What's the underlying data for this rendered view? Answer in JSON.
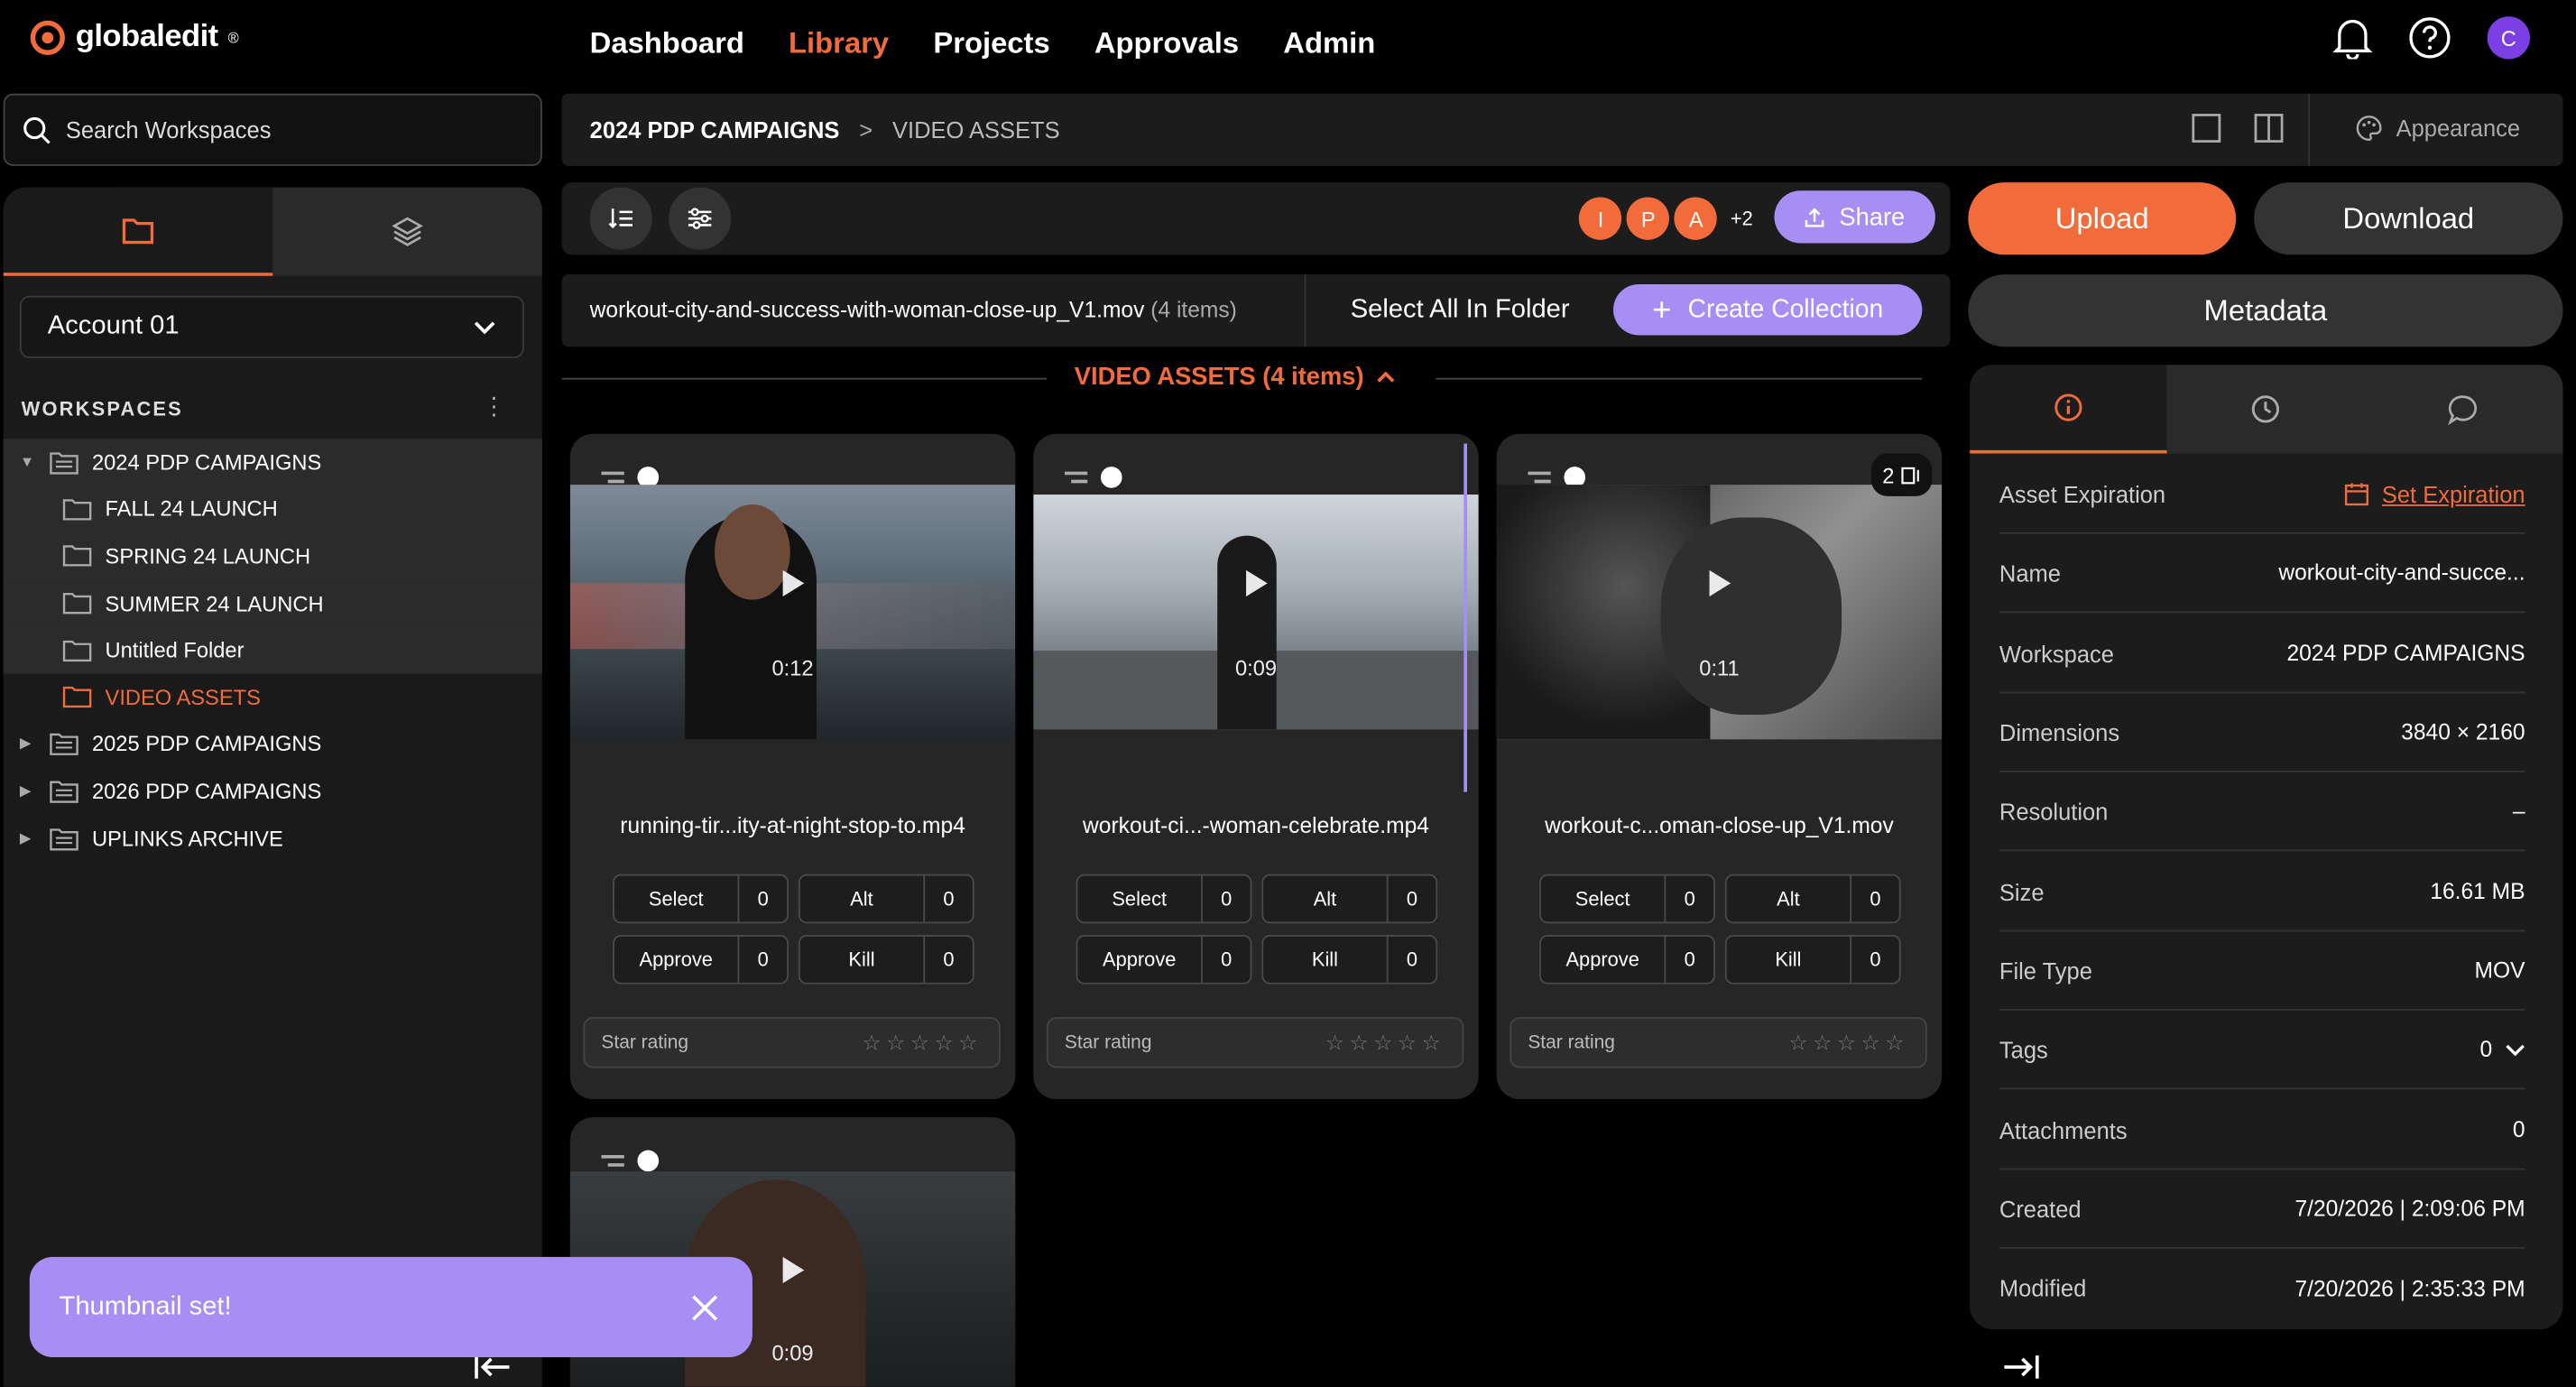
{
  "brand": {
    "name": "globaledit",
    "mark": "®"
  },
  "nav": {
    "items": [
      "Dashboard",
      "Library",
      "Projects",
      "Approvals",
      "Admin"
    ],
    "active": "Library"
  },
  "user": {
    "initial": "C"
  },
  "sidebar": {
    "search_placeholder": "Search Workspaces",
    "account": "Account 01",
    "workspaces_label": "WORKSPACES",
    "tree": [
      {
        "label": "2024 PDP CAMPAIGNS",
        "expanded": true,
        "children": [
          "FALL 24 LAUNCH",
          "SPRING 24 LAUNCH",
          "SUMMER 24 LAUNCH",
          "Untitled Folder",
          "VIDEO ASSETS"
        ]
      },
      {
        "label": "2025 PDP CAMPAIGNS"
      },
      {
        "label": "2026 PDP CAMPAIGNS"
      },
      {
        "label": "UPLINKS ARCHIVE"
      }
    ]
  },
  "breadcrumb": {
    "root": "2024 PDP CAMPAIGNS",
    "sep": ">",
    "current": "VIDEO ASSETS"
  },
  "appearance_label": "Appearance",
  "toolbar": {
    "avatars": [
      "I",
      "P",
      "A"
    ],
    "more": "+2",
    "share": "Share"
  },
  "selection": {
    "filename": "workout-city-and-success-with-woman-close-up_V1.mov",
    "count": "(4 items)",
    "select_all": "Select All In Folder",
    "create_collection": "Create Collection"
  },
  "section": {
    "title": "VIDEO ASSETS (4 items)"
  },
  "cards": [
    {
      "name": "running-tir...ity-at-night-stop-to.mp4",
      "duration": "0:12",
      "select": "Select",
      "select_n": "0",
      "alt": "Alt",
      "alt_n": "0",
      "approve": "Approve",
      "approve_n": "0",
      "kill": "Kill",
      "kill_n": "0",
      "star": "Star rating"
    },
    {
      "name": "workout-ci...-woman-celebrate.mp4",
      "duration": "0:09",
      "select": "Select",
      "select_n": "0",
      "alt": "Alt",
      "alt_n": "0",
      "approve": "Approve",
      "approve_n": "0",
      "kill": "Kill",
      "kill_n": "0",
      "star": "Star rating"
    },
    {
      "name": "workout-c...oman-close-up_V1.mov",
      "duration": "0:11",
      "badge": "2",
      "select": "Select",
      "select_n": "0",
      "alt": "Alt",
      "alt_n": "0",
      "approve": "Approve",
      "approve_n": "0",
      "kill": "Kill",
      "kill_n": "0",
      "star": "Star rating"
    },
    {
      "duration": "0:09"
    }
  ],
  "actions": {
    "upload": "Upload",
    "download": "Download",
    "metadata": "Metadata"
  },
  "meta": [
    {
      "k": "Asset Expiration",
      "v": "Set Expiration"
    },
    {
      "k": "Name",
      "v": "workout-city-and-succe..."
    },
    {
      "k": "Workspace",
      "v": "2024 PDP CAMPAIGNS"
    },
    {
      "k": "Dimensions",
      "v": "3840 × 2160"
    },
    {
      "k": "Resolution",
      "v": "–"
    },
    {
      "k": "Size",
      "v": "16.61 MB"
    },
    {
      "k": "File Type",
      "v": "MOV"
    },
    {
      "k": "Tags",
      "v": "0"
    },
    {
      "k": "Attachments",
      "v": "0"
    },
    {
      "k": "Created",
      "v": "7/20/2026 | 2:09:06 PM"
    },
    {
      "k": "Modified",
      "v": "7/20/2026 | 2:35:33 PM"
    }
  ],
  "toast": {
    "message": "Thumbnail set!"
  },
  "colors": {
    "accent": "#f26b3a",
    "purple": "#a68ef5",
    "avatar": "#7b3fe4"
  }
}
